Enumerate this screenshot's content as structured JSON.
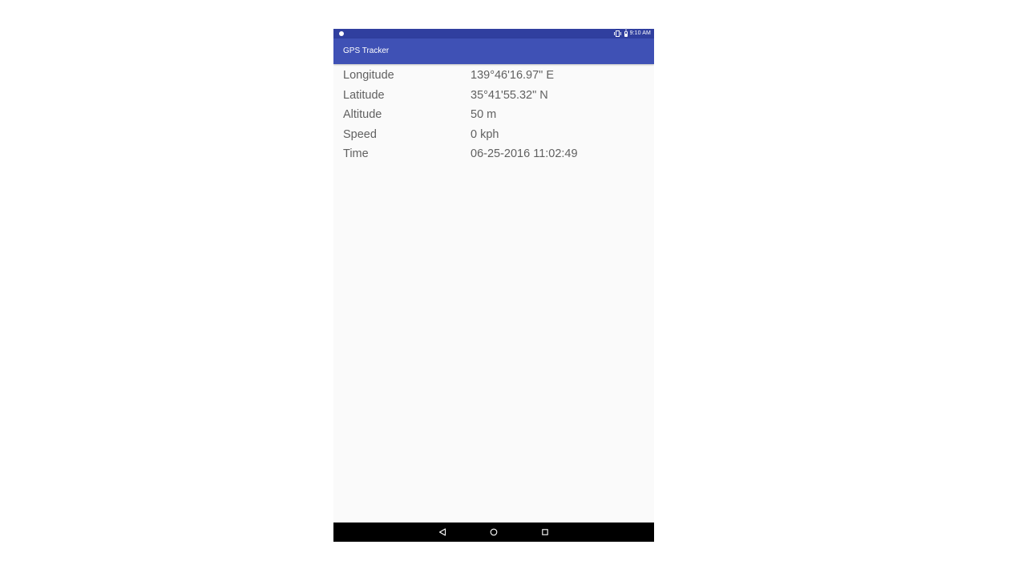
{
  "status_bar": {
    "time": "9:10 AM",
    "icons": [
      "notification-dot-icon",
      "vibrate-icon",
      "battery-icon"
    ]
  },
  "app_bar": {
    "title": "GPS Tracker"
  },
  "colors": {
    "primary": "#3f51b5",
    "primary_dark": "#303f9f",
    "background": "#fafafa",
    "text": "#616161"
  },
  "location": {
    "rows": [
      {
        "label": "Longitude",
        "value": "139°46'16.97\" E"
      },
      {
        "label": "Latitude",
        "value": "35°41'55.32\" N"
      },
      {
        "label": "Altitude",
        "value": "50 m"
      },
      {
        "label": "Speed",
        "value": "0 kph"
      },
      {
        "label": "Time",
        "value": "06-25-2016 11:02:49"
      }
    ]
  },
  "nav_bar": {
    "icons": [
      "back-icon",
      "home-icon",
      "recents-icon"
    ]
  }
}
